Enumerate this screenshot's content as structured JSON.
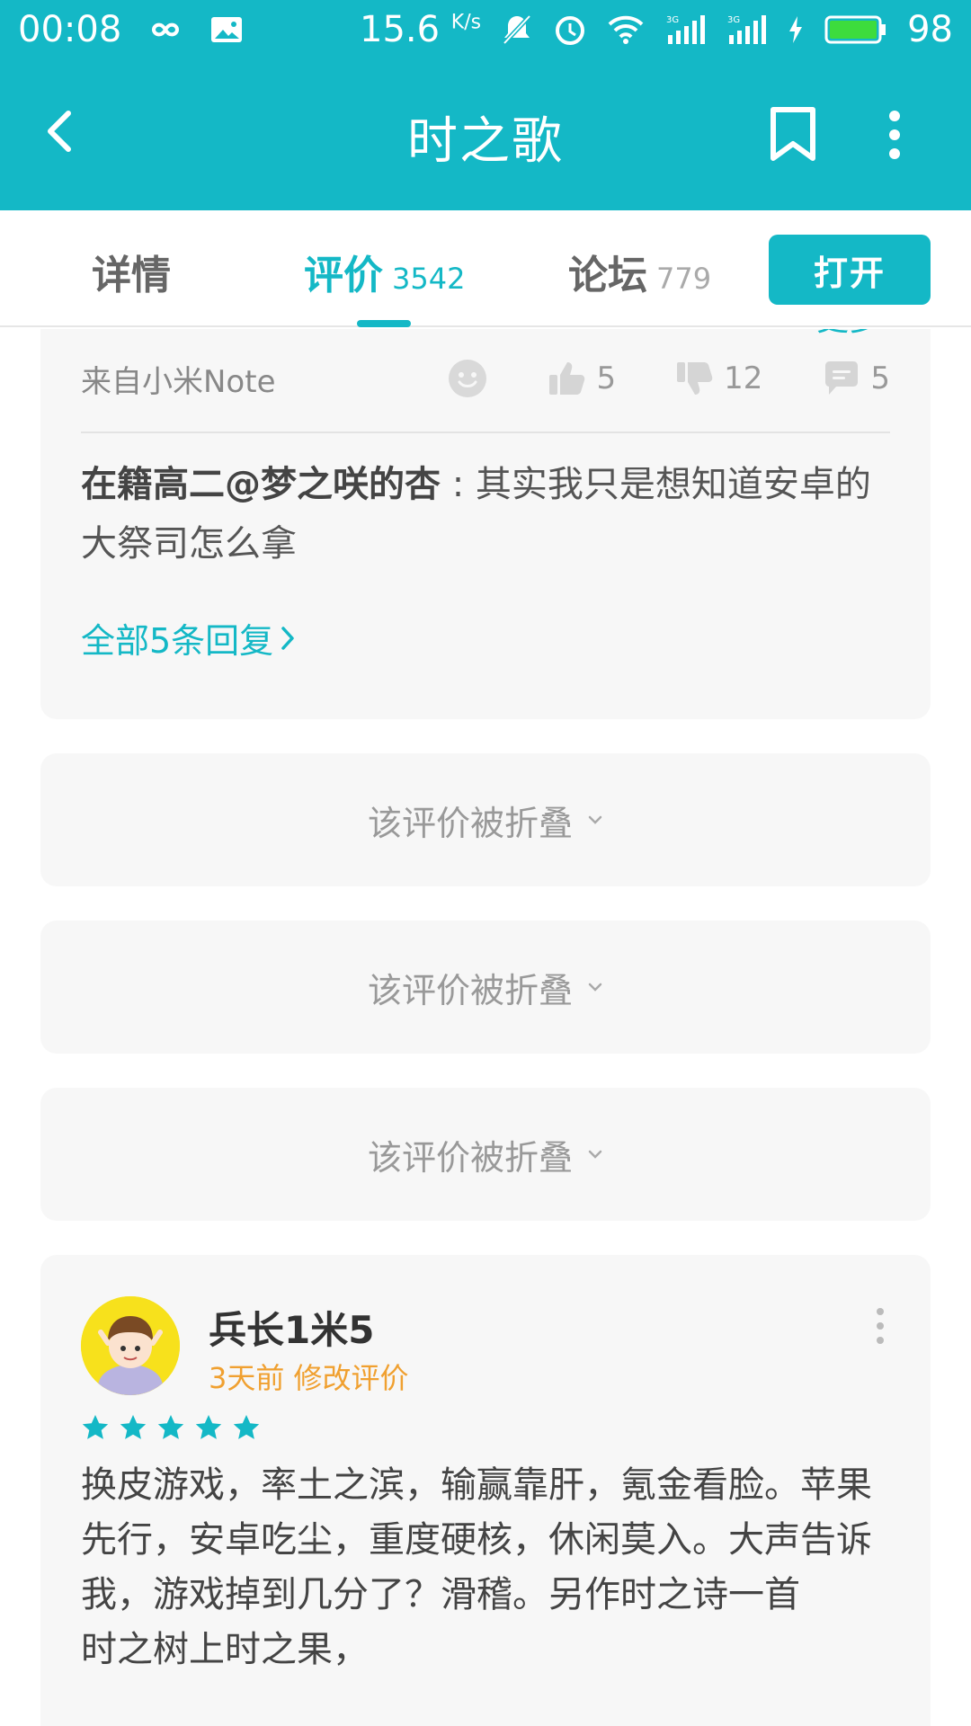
{
  "status_bar": {
    "time": "00:08",
    "speed_value": "15.6",
    "speed_unit": "K/s",
    "network_left": "3G",
    "network_right": "3G",
    "battery": "98",
    "icons": [
      "infinity-icon",
      "image-icon",
      "mute-bell-icon",
      "alarm-icon",
      "wifi-icon",
      "signal-icon",
      "signal-icon",
      "charging-icon",
      "battery-icon"
    ]
  },
  "app_bar": {
    "title": "时之歌",
    "back_icon": "back-chevron-icon",
    "bookmark_icon": "bookmark-icon",
    "more_icon": "more-vertical-icon",
    "color": "#14b8c6"
  },
  "tabs": [
    {
      "label": "详情",
      "count": ""
    },
    {
      "label": "评价",
      "count": "3542"
    },
    {
      "label": "论坛",
      "count": "779"
    }
  ],
  "open_button": "打开",
  "review1": {
    "more_link": "更多",
    "device": "来自小米Note",
    "likes": "5",
    "dislikes": "12",
    "comments": "5",
    "reply_author": "在籍高二@梦之咲的杏",
    "reply_sep": " : ",
    "reply_text": "其实我只是想知道安卓的大祭司怎么拿",
    "all_replies": "全部5条回复"
  },
  "folded": [
    {
      "label": "该评价被折叠"
    },
    {
      "label": "该评价被折叠"
    },
    {
      "label": "该评价被折叠"
    }
  ],
  "review2": {
    "username": "兵长1米5",
    "time": "3天前",
    "edited": "修改评价",
    "rating": 5,
    "max_rating": 5,
    "body": "换皮游戏，率土之滨，输赢靠肝，氪金看脸。苹果先行，安卓吃尘，重度硬核，休闲莫入。大声告诉我，游戏掉到几分了？滑稽。另作时之诗一首\n时之树上时之果，"
  }
}
